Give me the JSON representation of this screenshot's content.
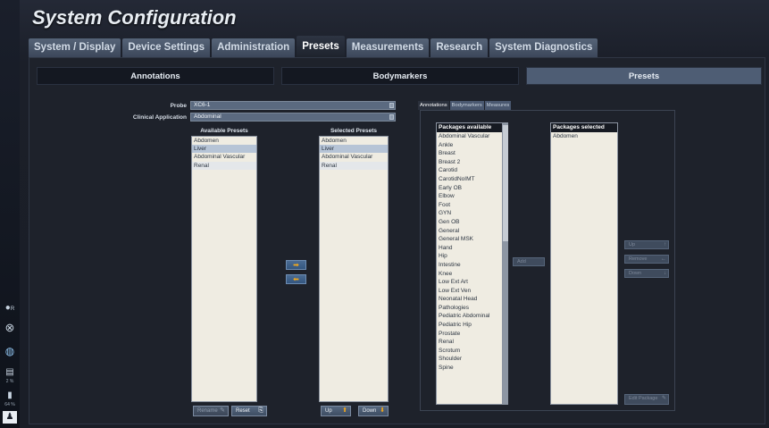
{
  "title": "System Configuration",
  "top_tabs": [
    "System / Display",
    "Device Settings",
    "Administration",
    "Presets",
    "Measurements",
    "Research",
    "System Diagnostics"
  ],
  "sub_tabs": [
    "Annotations",
    "Bodymarkers",
    "Presets"
  ],
  "probe": {
    "label": "Probe",
    "value": "XC6-1"
  },
  "clinical_application": {
    "label": "Clinical Application",
    "value": "Abdominal"
  },
  "available_presets": {
    "header": "Available Presets",
    "items": [
      "Abdomen",
      "Liver",
      "Abdominal Vascular",
      "Renal"
    ]
  },
  "selected_presets": {
    "header": "Selected Presets",
    "items": [
      "Abdomen",
      "Liver",
      "Abdominal Vascular",
      "Renal"
    ]
  },
  "buttons": {
    "rename": "Rename",
    "reset": "Reset",
    "up": "Up",
    "down": "Down",
    "add": "Add",
    "pkg_up": "Up",
    "remove": "Remove",
    "pkg_down": "Down",
    "edit_package": "Edit Package"
  },
  "inner_tabs": [
    "Annotations",
    "Bodymarkers",
    "Measures"
  ],
  "packages_available": {
    "header": "Packages available",
    "items": [
      "Abdominal Vascular",
      "Ankle",
      "Breast",
      "Breast 2",
      "Carotid",
      "CarotidNoIMT",
      "Early OB",
      "Elbow",
      "Foot",
      "GYN",
      "Gen OB",
      "General",
      "General MSK",
      "Hand",
      "Hip",
      "Intestine",
      "Knee",
      "Low Ext Art",
      "Low Ext Ven",
      "Neonatal Head",
      "Pathologies",
      "Pediatric Abdominal",
      "Pediatric Hip",
      "Prostate",
      "Renal",
      "Scrotum",
      "Shoulder",
      "Spine"
    ]
  },
  "packages_selected": {
    "header": "Packages selected",
    "items": [
      "Abdomen"
    ]
  },
  "rail": {
    "r_label": "R",
    "t1": "2 %",
    "t2": "64 %"
  },
  "icons": [
    "pin-icon",
    "close-circle-icon",
    "globe-icon",
    "printer-icon",
    "battery-icon",
    "user-icon"
  ],
  "colors": {
    "accent": "#f3a81c",
    "active_tab": "#4e5d74"
  }
}
